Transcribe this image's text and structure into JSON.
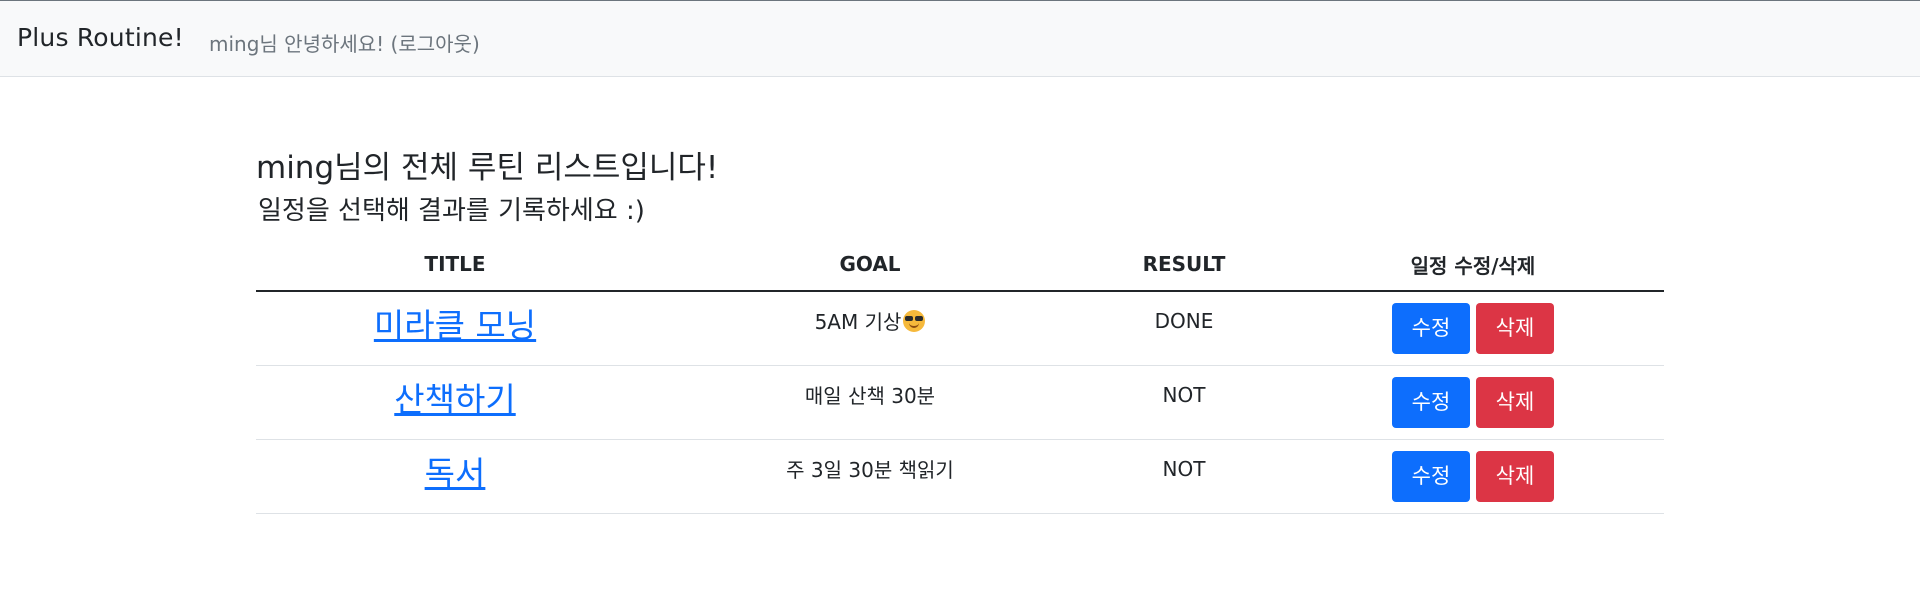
{
  "navbar": {
    "brand": "Plus Routine!",
    "greeting": "ming님 안녕하세요!",
    "logout": "(로그아웃)"
  },
  "main": {
    "heading": "ming님의 전체 루틴 리스트입니다!",
    "subheading": "일정을 선택해 결과를 기록하세요 :)"
  },
  "table": {
    "headers": [
      "TITLE",
      "GOAL",
      "RESULT",
      "일정 수정/삭제"
    ],
    "rows": [
      {
        "title": "미라클 모닝",
        "goal": "5AM 기상",
        "goal_icon": "sunglasses-face-icon",
        "result": "DONE",
        "edit": "수정",
        "delete": "삭제"
      },
      {
        "title": "산책하기",
        "goal": "매일 산책 30분",
        "result": "NOT",
        "edit": "수정",
        "delete": "삭제"
      },
      {
        "title": "독서",
        "goal": "주 3일 30분 책읽기",
        "result": "NOT",
        "edit": "수정",
        "delete": "삭제"
      }
    ]
  },
  "colors": {
    "primary": "#0d6efd",
    "danger": "#dc3545",
    "navbar_bg": "#f8f9fa",
    "muted": "#6c757d"
  }
}
